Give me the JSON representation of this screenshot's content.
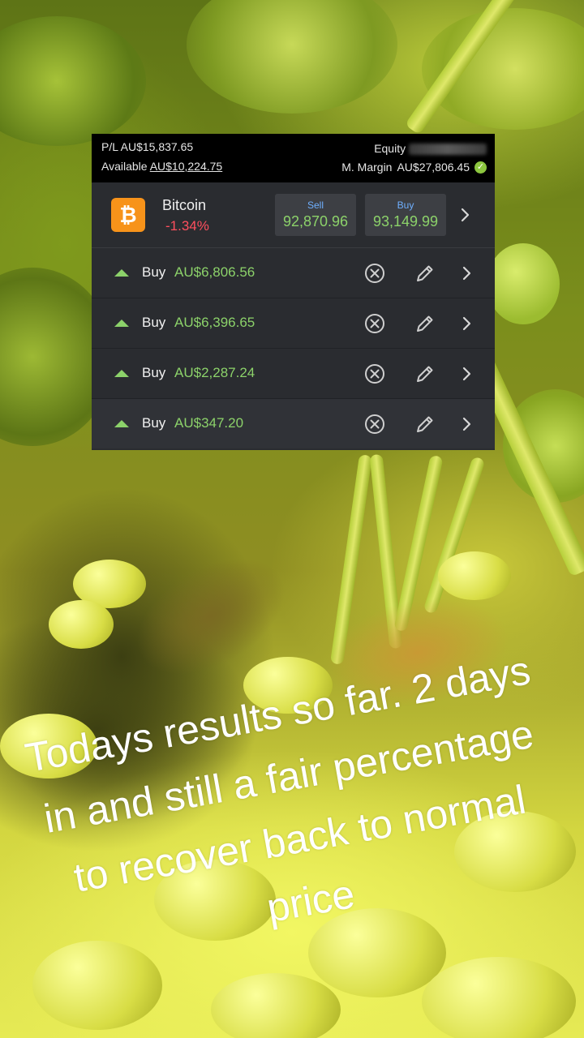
{
  "account": {
    "pl_label": "P/L",
    "pl_value": "AU$15,837.65",
    "available_label": "Available",
    "available_value": "AU$10,224.75",
    "equity_label": "Equity",
    "margin_label": "M. Margin",
    "margin_value": "AU$27,806.45"
  },
  "instrument": {
    "name": "Bitcoin",
    "change": "-1.34%",
    "sell_label": "Sell",
    "sell_value": "92,870.96",
    "buy_label": "Buy",
    "buy_value": "93,149.99",
    "icon": "bitcoin-icon"
  },
  "positions": [
    {
      "side": "Buy",
      "amount": "AU$6,806.56"
    },
    {
      "side": "Buy",
      "amount": "AU$6,396.65"
    },
    {
      "side": "Buy",
      "amount": "AU$2,287.24"
    },
    {
      "side": "Buy",
      "amount": "AU$347.20"
    }
  ],
  "caption": "Todays results so far. 2 days\nin and still a fair percentage\nto recover back to normal\nprice",
  "colors": {
    "positive": "#8cd26a",
    "negative": "#ff4f5e",
    "bitcoin": "#f7931a",
    "panel": "#2a2c30"
  }
}
